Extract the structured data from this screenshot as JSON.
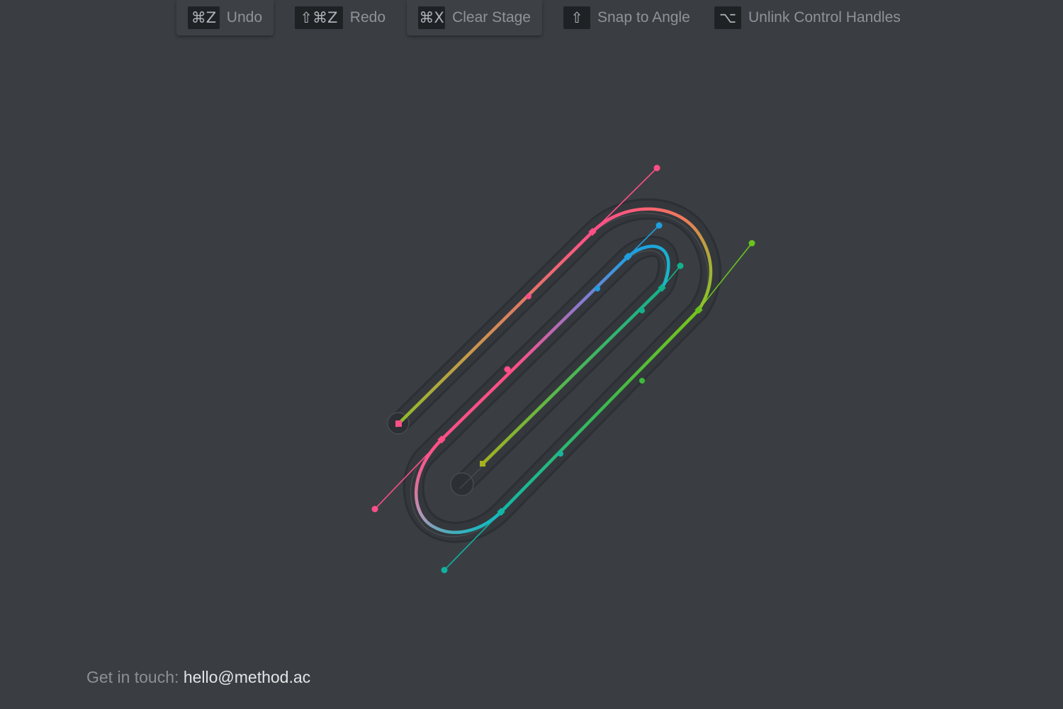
{
  "toolbar": {
    "items": [
      {
        "key": "⌘Z",
        "label": "Undo"
      },
      {
        "key": "⇧⌘Z",
        "label": "Redo"
      },
      {
        "key": "⌘X",
        "label": "Clear Stage"
      },
      {
        "key": "⇧",
        "label": "Snap to Angle"
      },
      {
        "key": "⌥",
        "label": "Unlink Control Handles"
      }
    ]
  },
  "footer": {
    "prefix": "Get in touch:",
    "email": "hello@method.ac"
  },
  "colors": {
    "background": "#3a3e42",
    "pink": "#ff4f86",
    "blue": "#1f9fe0",
    "cyan": "#1cc6d8",
    "teal": "#14b08e",
    "green": "#6ac21f",
    "olive": "#a4b21c",
    "orange": "#f0884a"
  }
}
